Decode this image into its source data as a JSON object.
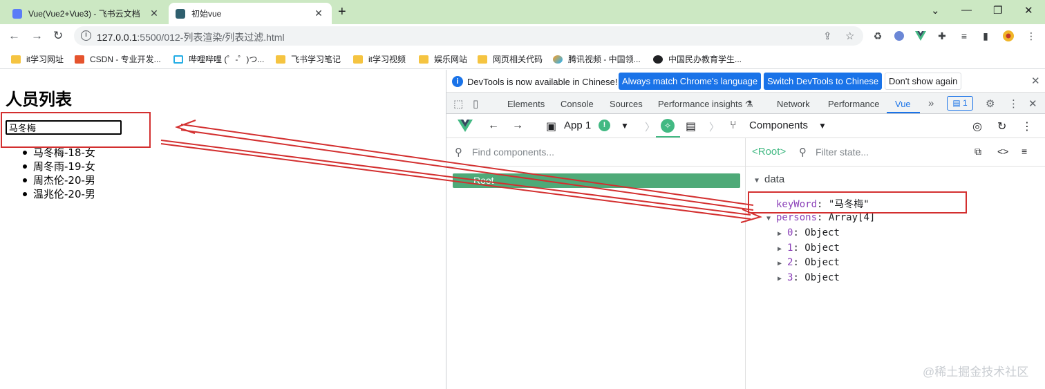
{
  "browser": {
    "tabs": [
      {
        "title": "Vue(Vue2+Vue3) - 飞书云文档",
        "favicon_color": "#5b7cf7"
      },
      {
        "title": "初始vue",
        "favicon_color": "#2f5f6e"
      }
    ],
    "address": {
      "host": "127.0.0.1",
      "path": ":5500/012-列表渲染/列表过滤.html"
    },
    "bookmarks": [
      {
        "label": "it学习网址",
        "icon": "folder-icon"
      },
      {
        "label": "CSDN - 专业开发...",
        "icon": "csdn-icon"
      },
      {
        "label": "哔哩哔哩 (゜-゜)つ...",
        "icon": "bilibili-icon"
      },
      {
        "label": "飞书学习笔记",
        "icon": "folder-icon"
      },
      {
        "label": "it学习视频",
        "icon": "folder-icon"
      },
      {
        "label": "娱乐网站",
        "icon": "folder-icon"
      },
      {
        "label": "网页相关代码",
        "icon": "folder-icon"
      },
      {
        "label": "腾讯视频 - 中国领...",
        "icon": "tencent-video-icon"
      },
      {
        "label": "中国民办教育学生...",
        "icon": "globe-icon"
      }
    ]
  },
  "page": {
    "title": "人员列表",
    "keyword_value": "马冬梅",
    "persons": [
      "马冬梅-18-女",
      "周冬雨-19-女",
      "周杰伦-20-男",
      "温兆伦-20-男"
    ]
  },
  "devtools": {
    "infobar": {
      "message": "DevTools is now available in Chinese!",
      "btn_match": "Always match Chrome's language",
      "btn_switch": "Switch DevTools to Chinese",
      "btn_dismiss": "Don't show again"
    },
    "tabs": [
      "Elements",
      "Console",
      "Sources",
      "Performance insights",
      "Network",
      "Performance",
      "Vue"
    ],
    "active_tab": "Vue",
    "issues_count": "1",
    "vue": {
      "app_label": "App 1",
      "components_label": "Components",
      "find_placeholder": "Find components...",
      "root_item": "Root",
      "root_tag": "<Root>",
      "filter_placeholder": "Filter state...",
      "section": "data",
      "keyword_key": "keyWord",
      "keyword_val": "\"马冬梅\"",
      "persons_key": "persons",
      "persons_val": "Array[4]",
      "items": [
        {
          "index": "0",
          "value": "Object"
        },
        {
          "index": "1",
          "value": "Object"
        },
        {
          "index": "2",
          "value": "Object"
        },
        {
          "index": "3",
          "value": "Object"
        }
      ]
    }
  },
  "watermark": "@稀土掘金技术社区",
  "colors": {
    "vue_green": "#42b983",
    "annotation_red": "#d32f2f",
    "tabstrip": "#cce8c3",
    "link_blue": "#1a73e8"
  }
}
